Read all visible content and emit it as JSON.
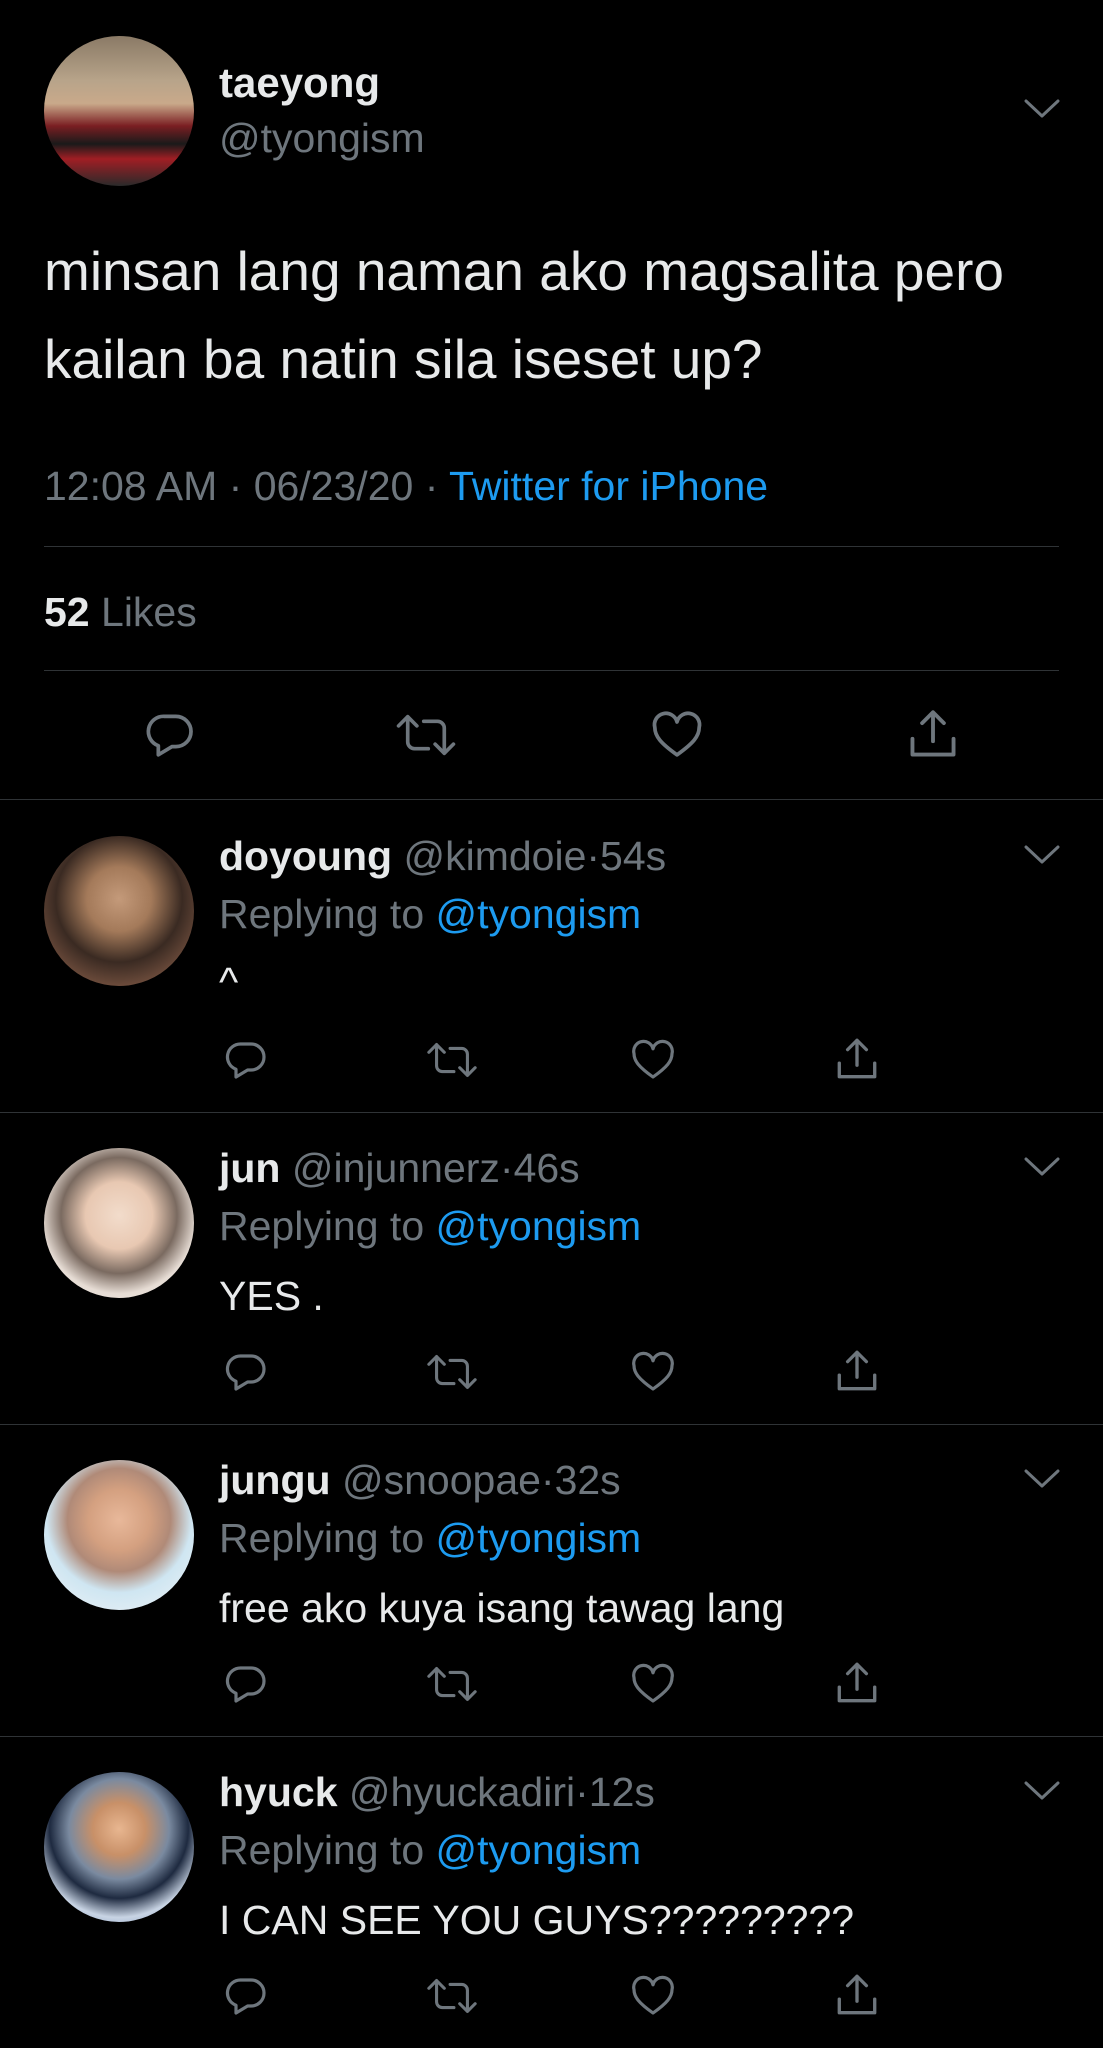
{
  "main_tweet": {
    "display_name": "taeyong",
    "handle": "@tyongism",
    "text_line1": "minsan lang naman ako magsalita pero",
    "text_line2": "kailan ba natin sila iseset up?",
    "time": "12:08 AM",
    "date": "06/23/20",
    "sep": "·",
    "source": "Twitter for iPhone",
    "likes_count": "52",
    "likes_label": "Likes"
  },
  "replies": [
    {
      "display_name": "doyoung",
      "handle": "@kimdoie",
      "sep": "·",
      "age": "54s",
      "replying_label": "Replying to",
      "replying_handle": "@tyongism",
      "text": "^"
    },
    {
      "display_name": "jun",
      "handle": "@injunnerz",
      "sep": "·",
      "age": "46s",
      "replying_label": "Replying to",
      "replying_handle": "@tyongism",
      "text": "YES ."
    },
    {
      "display_name": "jungu",
      "handle": "@snoopae",
      "sep": "·",
      "age": "32s",
      "replying_label": "Replying to",
      "replying_handle": "@tyongism",
      "text": "free ako kuya isang tawag lang"
    },
    {
      "display_name": "hyuck",
      "handle": "@hyuckadiri",
      "sep": "·",
      "age": "12s",
      "replying_label": "Replying to",
      "replying_handle": "@tyongism",
      "text": "I CAN SEE YOU GUYS?????????"
    }
  ],
  "icons": {
    "reply": "reply-icon",
    "retweet": "retweet-icon",
    "like": "heart-icon",
    "share": "share-icon",
    "menu": "chevron-down-icon"
  },
  "colors": {
    "background": "#000000",
    "text": "#e7e9ea",
    "secondary": "#6e767d",
    "accent": "#1d9bf0",
    "divider": "#2f3336"
  }
}
